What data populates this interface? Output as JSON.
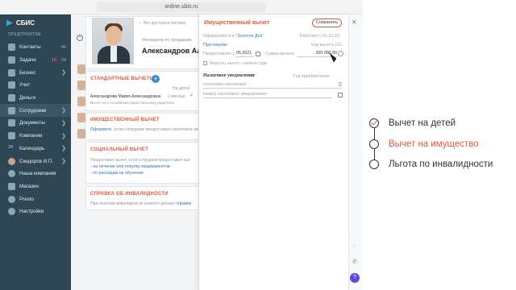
{
  "browser": {
    "url": "online.sbis.ru"
  },
  "sidebar": {
    "logo": "СБИС",
    "subtitle": "ПРЕДПРИЯТИЕ",
    "items": [
      {
        "label": "Контакты",
        "badge": "46",
        "icon": "contacts-icon"
      },
      {
        "label": "Задачи",
        "badge": "16",
        "badge2": "24",
        "icon": "tasks-icon"
      },
      {
        "label": "Бизнес",
        "chevron": "❯",
        "icon": "business-icon"
      },
      {
        "label": "Учет",
        "icon": "accounting-icon"
      },
      {
        "label": "Деньги",
        "icon": "money-icon"
      },
      {
        "label": "Сотрудники",
        "chevron": "❯",
        "icon": "employees-icon"
      },
      {
        "label": "Документы",
        "chevron": "❯",
        "icon": "documents-icon"
      },
      {
        "label": "Компании",
        "chevron": "❯",
        "icon": "companies-icon"
      },
      {
        "label": "Календарь",
        "chevron": "❯",
        "icon": "calendar-icon",
        "icon_text": "24"
      },
      {
        "label": "Скидоров И.П.",
        "chevron": "❯",
        "icon": "avatar-icon"
      },
      {
        "label": "Наша компания",
        "icon": "company-icon"
      },
      {
        "label": "Магазин",
        "icon": "shop-icon"
      },
      {
        "label": "Presto",
        "icon": "presto-icon"
      },
      {
        "label": "Настройки",
        "icon": "settings-icon"
      }
    ]
  },
  "profile": {
    "availability": "Нет доступа в систему",
    "role": "Менеджер по продажам",
    "name": "Александров Але"
  },
  "sections": {
    "standard": {
      "title": "СТАНДАРТНЫЕ ВЫЧЕТЫ",
      "sort": "На детей",
      "child_name": "Александрова Мария Александровна",
      "child_age": "2 месяца",
      "child_note": "Вычет на 1-го ребенка единственному родителю"
    },
    "property": {
      "title": "ИМУЩЕСТВЕННЫЙ ВЫЧЕТ",
      "link": "Оформите",
      "text": ", если сотрудник предоставил налоговое уве"
    },
    "social": {
      "title": "СОЦИАЛЬНЫЙ ВЫЧЕТ",
      "text1": "Предоставит вычет, если сотрудник предоставил нал",
      "link1": "- на лечение или покупку медикаментов",
      "link2": "- по расходам на обучение"
    },
    "disability": {
      "title": "СПРАВКА ОБ ИНВАЛИДНОСТИ",
      "text": "При наличии инвалидности укажите данные",
      "link": "справки"
    }
  },
  "panel": {
    "title": "Имущественный вычет",
    "save": "Сохранить",
    "issued_label": "Оформляется в",
    "issued_value": "\"Золотое Дно\"",
    "works_since": "Работает с 01.01.20",
    "purchase": "При покупке",
    "income_code": "Код вычета 101",
    "provided_from": "Предоставлен с",
    "date": "05.2021",
    "sum_label": "Сумма вычета",
    "sum_value": "200 000,00",
    "refund_label": "Вернуть налог с начала года",
    "notice_title": "Налоговое уведомление",
    "acq_year": "Год приобретения",
    "inspection": "Налоговая инспекция",
    "notice_number": "Номер налогового уведомления"
  },
  "steps": [
    {
      "label": "Вычет на детей",
      "state": "done"
    },
    {
      "label": "Вычет на имущество",
      "state": "active"
    },
    {
      "label": "Льгота по инвалидности",
      "state": "todo"
    }
  ],
  "colors": {
    "accent": "#e0583a",
    "sidebar": "#2f4654",
    "link": "#2e73b8"
  }
}
